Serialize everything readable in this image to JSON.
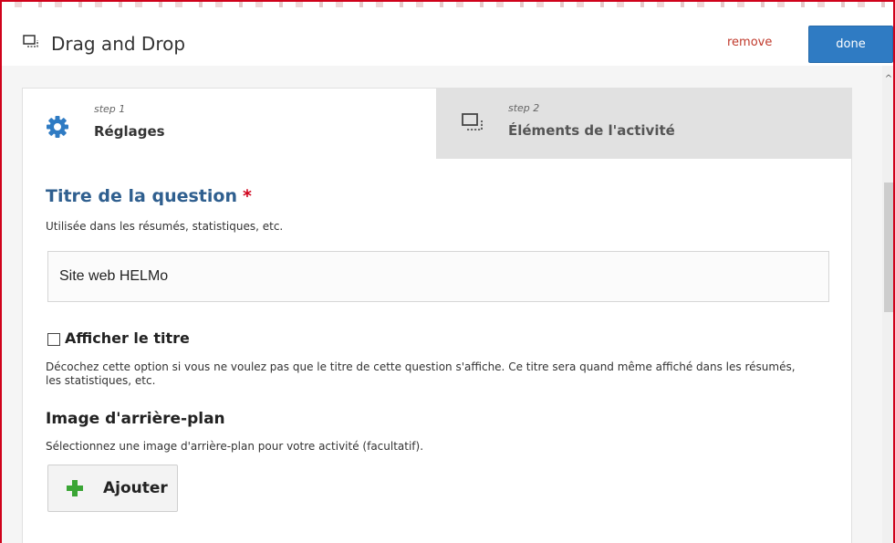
{
  "header": {
    "title": "Drag and Drop",
    "icon": "drag-drop-icon",
    "remove_label": "remove",
    "done_label": "done"
  },
  "tabs": [
    {
      "step": "step 1",
      "title": "Réglages",
      "icon": "gear-icon",
      "active": true
    },
    {
      "step": "step 2",
      "title": "Éléments de l'activité",
      "icon": "drag-drop-icon",
      "active": false
    }
  ],
  "form": {
    "question_title": {
      "label": "Titre de la question",
      "required_mark": "*",
      "description": "Utilisée dans les résumés, statistiques, etc.",
      "value": "Site web HELMo"
    },
    "show_title": {
      "label": "Afficher le titre",
      "checked": false,
      "description": "Décochez cette option si vous ne voulez pas que le titre de cette question s'affiche. Ce titre sera quand même affiché dans les résumés, les statistiques, etc."
    },
    "background_image": {
      "label": "Image d'arrière-plan",
      "description": "Sélectionnez une image d'arrière-plan pour votre activité (facultatif).",
      "add_label": "Ajouter"
    }
  },
  "colors": {
    "accent": "#2f7bc3",
    "title_blue": "#2f5f8f",
    "required_red": "#d0021b",
    "add_green": "#3aa535",
    "gear_blue": "#2f7bc3"
  }
}
